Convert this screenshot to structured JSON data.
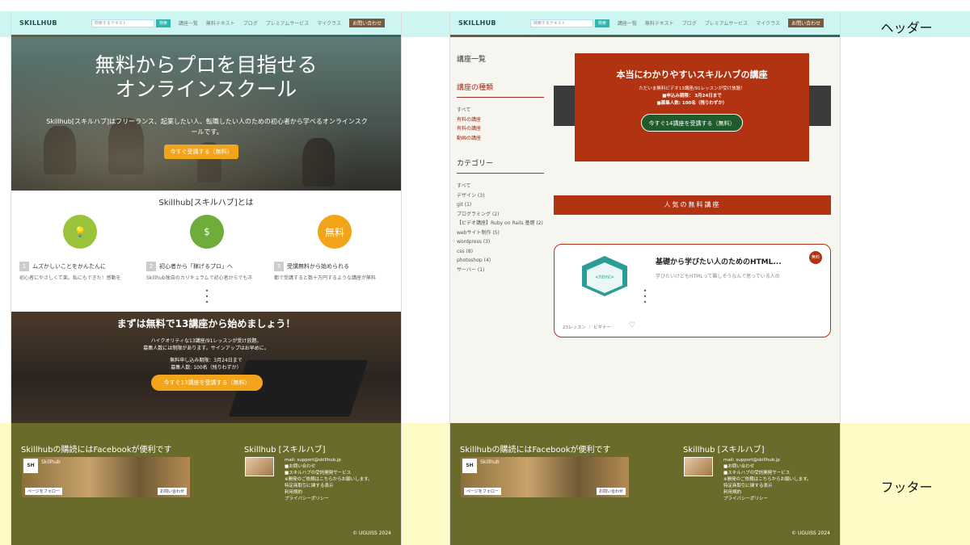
{
  "labels": {
    "header": "ヘッダー",
    "footer": "フッター"
  },
  "header": {
    "logo": "SKILLHUB",
    "search_placeholder": "検索するテキスト",
    "search_button": "検索",
    "nav": [
      "講座一覧",
      "無料テキスト",
      "ブログ",
      "プレミアムサービス",
      "マイクラス"
    ],
    "contact": "お問い合わせ"
  },
  "pageA": {
    "hero_title_1": "無料からプロを目指せる",
    "hero_title_2": "オンラインスクール",
    "hero_sub": "Skillhub[スキルハブ]はフリーランス、起業したい人、転職したい人のための初心者から学べるオンラインスクールです。",
    "hero_cta": "今すぐ受講する（無料）",
    "about_title": "Skillhub[スキルハブ]とは",
    "features": [
      {
        "num": "1",
        "title": "ムズかしいことをかんたんに",
        "desc": "初心者にやさしくて楽。私にもできた！感動を"
      },
      {
        "num": "2",
        "title": "初心者から「稼げるプロ」へ",
        "desc": "Skillhub独自のカリキュラムで初心者からでもネ"
      },
      {
        "num": "3",
        "title": "受講無料から始められる",
        "desc": "都で受講すると数十万円するような講座が無料"
      }
    ],
    "feature_icon_text": "無料",
    "cta_title": "まずは無料で13講座から始めましょう！",
    "cta_line1": "ハイクオリティな13講座/91レッスンが受け放題。",
    "cta_line2": "募集人数には制限があります。サインアップはお早めに。",
    "cta_line3": "無料申し込み期限：3月24日まで",
    "cta_line4": "募集人数: 100名（残りわずか）",
    "cta_button": "今すぐ13講座を受講する（無料）"
  },
  "pageB": {
    "side_title": "講座一覧",
    "side_kinds": "講座の種類",
    "kinds": [
      "すべて",
      "有料の講座",
      "有料の講座",
      "動画の講座"
    ],
    "side_cats": "カテゴリー",
    "cats": [
      "すべて",
      "デザイン (3)",
      "git (1)",
      "プログラミング (2)",
      "【ビデオ講座】Ruby on Rails 基礎 (2)",
      "webサイト制作 (5)",
      "wordpress (3)",
      "css (8)",
      "photoshop (4)",
      "サーバー (1)"
    ],
    "box_title": "本当にわかりやすいスキルハブの講座",
    "box_line1": "ただいま無料ビデオ13講座/91レッスンが受け放題！",
    "box_line2": "■申込み期限： 3月24日まで",
    "box_line3": "■募集人数: 100名（残りわずか）",
    "box_button": "今すぐ14講座を受講する（無料）",
    "popular": "人気の無料講座",
    "card_title": "基礎から学びたい人のためのHTML...",
    "card_desc": "学びたいけどもHTMLって難しそうなんで思っている人の",
    "card_badge": "無料",
    "card_hex": "<html>",
    "card_foot": "23レッスン ｜ ビギナー"
  },
  "footer": {
    "fb_heading": "Skillhubの購読にはFacebookが便利です",
    "fb_logo": "SH",
    "fb_name": "Skillhub",
    "fb_follow": "ページをフォロー",
    "fb_message": "お問い合わせ",
    "about_heading": "Skillhub [スキルハブ]",
    "links": [
      "mail: support@skillhub.jp",
      "■お問い合わせ",
      "■スキルハブの受託開発サービス",
      "※開発のご依頼はこちらからお願いします。",
      "特定商取引に関する表示",
      "利用規約",
      "プライバシーポリシー"
    ],
    "copyright": "© UGUISS 2024"
  },
  "colors": {
    "header_bg": "#cdf6f3",
    "accent_orange": "#f2a51b",
    "accent_red": "#b23312",
    "footer_bg": "#6a6a2a"
  }
}
